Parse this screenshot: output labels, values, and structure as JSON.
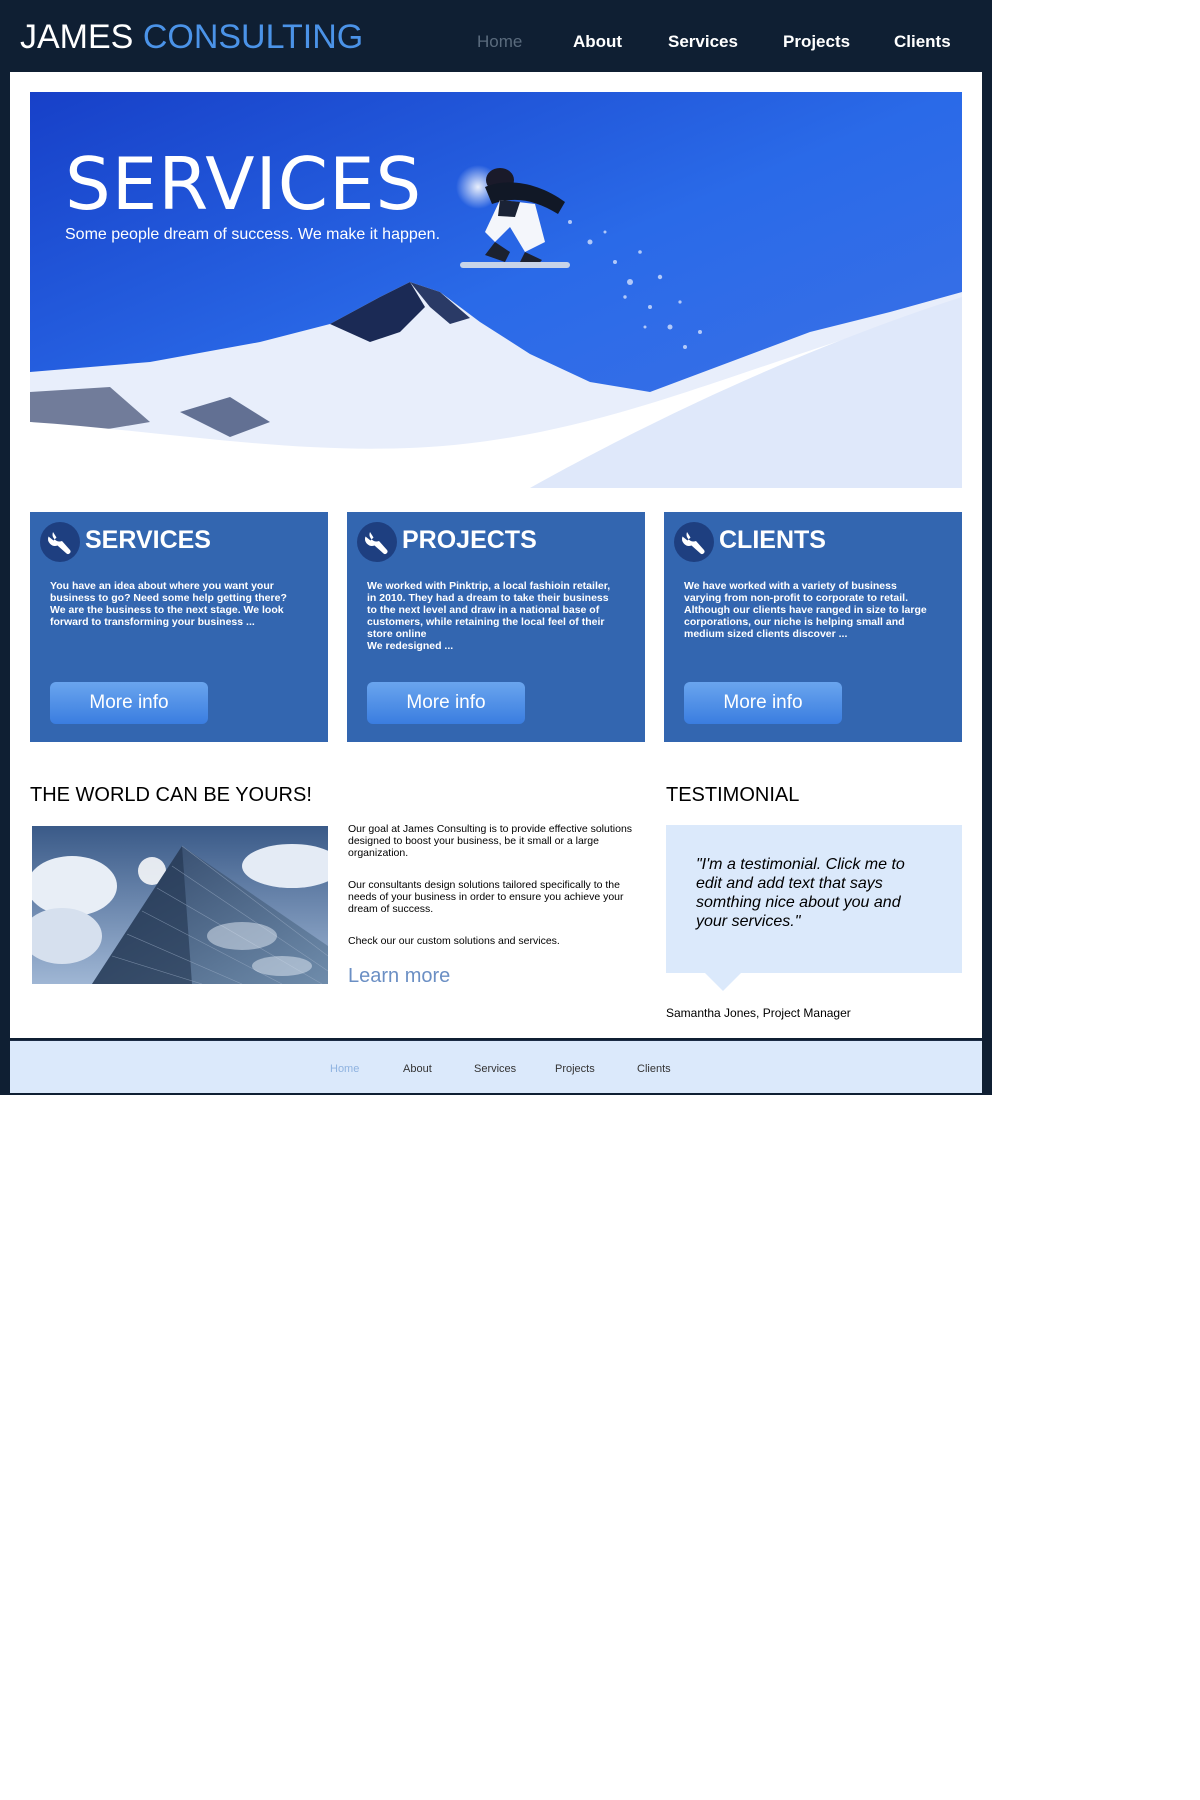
{
  "header": {
    "brand_first": "JAMES",
    "brand_second": "CONSULTING",
    "nav": [
      {
        "label": "Home",
        "active": true
      },
      {
        "label": "About",
        "active": false
      },
      {
        "label": "Services",
        "active": false
      },
      {
        "label": "Projects",
        "active": false
      },
      {
        "label": "Clients",
        "active": false
      }
    ]
  },
  "hero": {
    "title": "SERVICES",
    "subtitle": "Some people dream of success. We make it happen."
  },
  "cards": [
    {
      "title": "SERVICES",
      "body": "You have an idea about where you want your business to go? Need some help getting there? We are the business to the next stage. We look forward to transforming your business ...",
      "button": "More info"
    },
    {
      "title": "PROJECTS",
      "body": "We worked with Pinktrip, a local fashioin retailer, in 2010. They had a dream to take their business to the next level and draw in a national base of customers, while retaining the local feel of their store online\nWe redesigned ...",
      "button": "More info"
    },
    {
      "title": "CLIENTS",
      "body": "We have worked with a variety of business varying from non-profit to corporate to retail. Although our clients have ranged in size to large corporations, our niche is helping small and medium sized clients discover ...",
      "button": "More info"
    }
  ],
  "world": {
    "heading": "THE WORLD CAN BE YOURS!",
    "paragraphs": [
      "Our goal at James Consulting is to provide effective solutions designed to boost your business, be it small or a large organization.",
      "Our consultants design solutions tailored specifically to the needs of your business in order to ensure you achieve your dream of success.",
      "Check our our custom solutions and services."
    ],
    "learn_more": "Learn more"
  },
  "testimonial": {
    "heading": "TESTIMONIAL",
    "quote": "\"I'm a testimonial. Click me to edit and add text that says somthing nice about you and your services.\"",
    "author": "Samantha Jones, Project Manager"
  },
  "footer": {
    "nav": [
      {
        "label": "Home",
        "active": true
      },
      {
        "label": "About",
        "active": false
      },
      {
        "label": "Services",
        "active": false
      },
      {
        "label": "Projects",
        "active": false
      },
      {
        "label": "Clients",
        "active": false
      }
    ]
  },
  "colors": {
    "header_bg": "#0f1f33",
    "brand_accent": "#4b93e8",
    "card_bg": "#3366b0",
    "button": "#4a8be6",
    "footer_bg": "#dbe9fb",
    "link": "#6b8fc4"
  },
  "icons": {
    "card_icon": "wrench-icon"
  }
}
